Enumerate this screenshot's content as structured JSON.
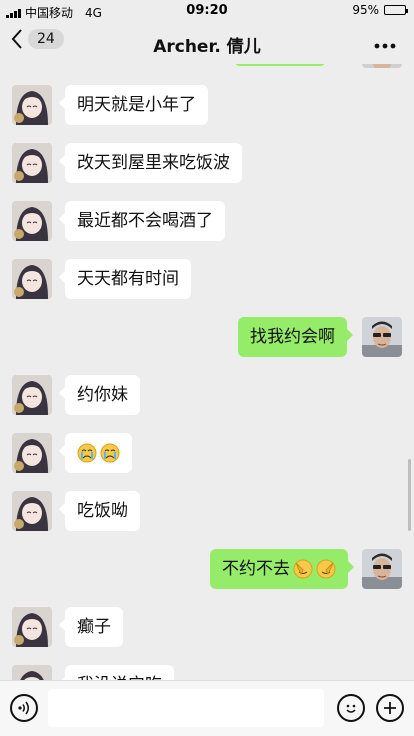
{
  "status_bar": {
    "carrier": "中国移动",
    "network": "4G",
    "time": "09:20",
    "battery": "95%",
    "battery_level": 0.95
  },
  "header": {
    "unread_count": "24",
    "title": "Archer. 倩儿"
  },
  "messages": [
    {
      "side": "in",
      "text": "明天就是小年了"
    },
    {
      "side": "in",
      "text": "改天到屋里来吃饭波"
    },
    {
      "side": "in",
      "text": "最近都不会喝酒了"
    },
    {
      "side": "in",
      "text": "天天都有时间"
    },
    {
      "side": "out",
      "text": "找我约会啊"
    },
    {
      "side": "in",
      "text": "约你妹"
    },
    {
      "side": "in",
      "text": "",
      "emojis": [
        "crying-face",
        "crying-face"
      ]
    },
    {
      "side": "in",
      "text": "吃饭呦"
    },
    {
      "side": "out",
      "text": "不约不去",
      "emojis": [
        "facepalm-face",
        "facepalm-face"
      ]
    },
    {
      "side": "in",
      "text": "癫子"
    },
    {
      "side": "in",
      "text": "我没说宁吃"
    }
  ],
  "colors": {
    "background": "#ededed",
    "incoming_bubble": "#ffffff",
    "outgoing_bubble": "#95ec69"
  },
  "icons": {
    "back": "chevron-left-icon",
    "more": "more-icon",
    "voice": "voice-icon",
    "emoji": "emoji-icon",
    "plus": "plus-icon"
  }
}
